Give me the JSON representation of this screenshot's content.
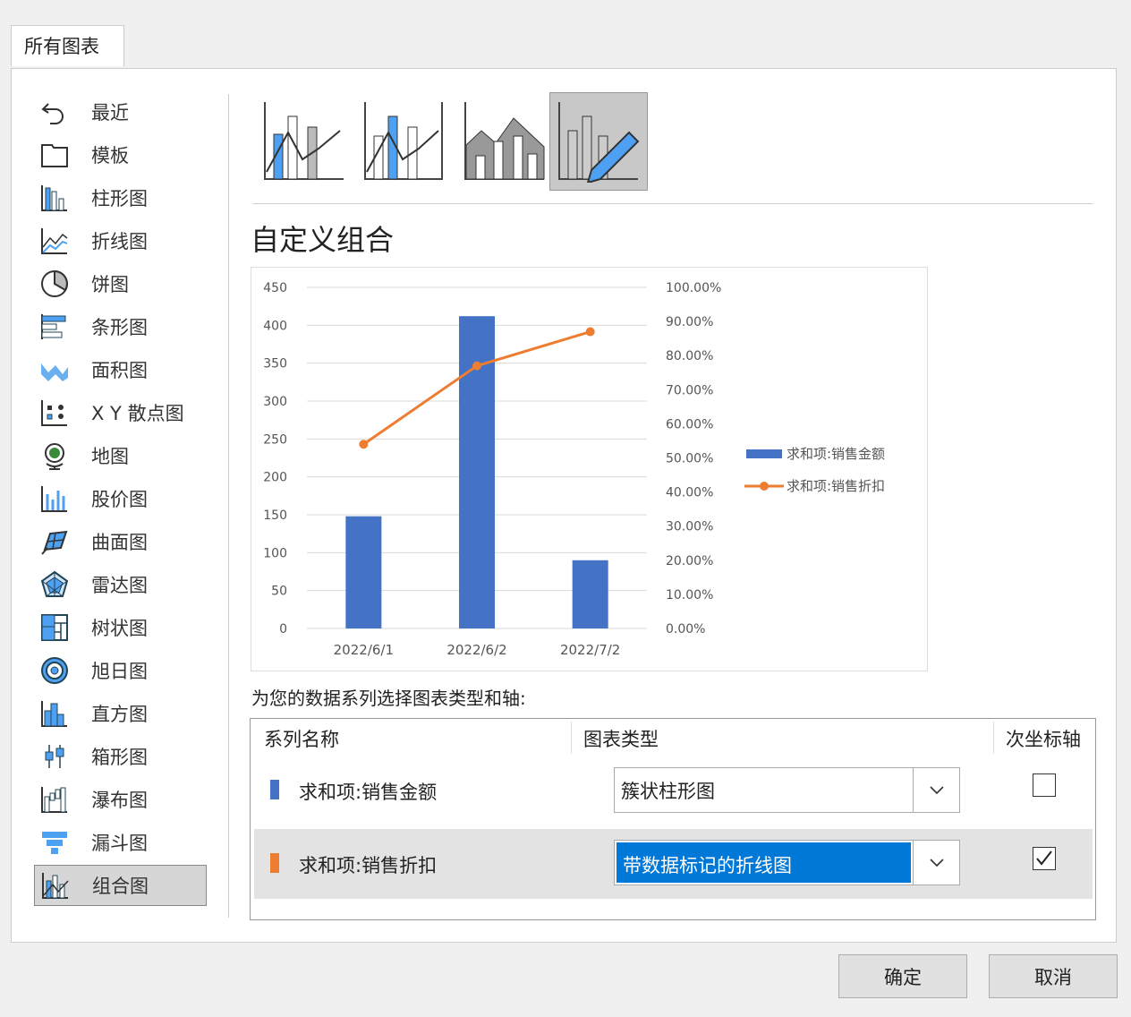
{
  "dialog": {
    "tab": "所有图表",
    "sidebar": {
      "items": [
        {
          "label": "最近",
          "icon": "undo-icon"
        },
        {
          "label": "模板",
          "icon": "folder-icon"
        },
        {
          "label": "柱形图",
          "icon": "column-chart-icon"
        },
        {
          "label": "折线图",
          "icon": "line-chart-icon"
        },
        {
          "label": "饼图",
          "icon": "pie-chart-icon"
        },
        {
          "label": "条形图",
          "icon": "bar-chart-icon"
        },
        {
          "label": "面积图",
          "icon": "area-chart-icon"
        },
        {
          "label": "X Y 散点图",
          "icon": "scatter-chart-icon"
        },
        {
          "label": "地图",
          "icon": "globe-icon"
        },
        {
          "label": "股价图",
          "icon": "stock-chart-icon"
        },
        {
          "label": "曲面图",
          "icon": "surface-chart-icon"
        },
        {
          "label": "雷达图",
          "icon": "radar-chart-icon"
        },
        {
          "label": "树状图",
          "icon": "treemap-icon"
        },
        {
          "label": "旭日图",
          "icon": "sunburst-icon"
        },
        {
          "label": "直方图",
          "icon": "histogram-icon"
        },
        {
          "label": "箱形图",
          "icon": "box-whisker-icon"
        },
        {
          "label": "瀑布图",
          "icon": "waterfall-icon"
        },
        {
          "label": "漏斗图",
          "icon": "funnel-icon"
        },
        {
          "label": "组合图",
          "icon": "combo-chart-icon",
          "selected": true
        }
      ]
    },
    "subtypes_selected": 3,
    "subtype_title": "自定义组合",
    "prompt": "为您的数据系列选择图表类型和轴:",
    "table": {
      "headers": [
        "系列名称",
        "图表类型",
        "次坐标轴"
      ],
      "rows": [
        {
          "name": "求和项:销售金额",
          "color": "#4472c4",
          "type": "簇状柱形图",
          "secondary": false
        },
        {
          "name": "求和项:销售折扣",
          "color": "#ed7d31",
          "type": "带数据标记的折线图",
          "secondary": true
        }
      ]
    },
    "buttons": {
      "ok": "确定",
      "cancel": "取消"
    }
  },
  "chart_data": {
    "type": "bar+line",
    "categories": [
      "2022/6/1",
      "2022/6/2",
      "2022/7/2"
    ],
    "series": [
      {
        "name": "求和项:销售金额",
        "type": "bar",
        "axis": "primary",
        "color": "#4472c4",
        "values": [
          148,
          412,
          90
        ]
      },
      {
        "name": "求和项:销售折扣",
        "type": "line",
        "axis": "secondary",
        "color": "#ed7d31",
        "values": [
          0.54,
          0.77,
          0.87
        ]
      }
    ],
    "y_ticks": [
      "0",
      "50",
      "100",
      "150",
      "200",
      "250",
      "300",
      "350",
      "400",
      "450"
    ],
    "y2_ticks": [
      "0.00%",
      "10.00%",
      "20.00%",
      "30.00%",
      "40.00%",
      "50.00%",
      "60.00%",
      "70.00%",
      "80.00%",
      "90.00%",
      "100.00%"
    ],
    "ylim": [
      0,
      450
    ],
    "y2lim": [
      0,
      1
    ],
    "grid": true,
    "legend": "right"
  }
}
